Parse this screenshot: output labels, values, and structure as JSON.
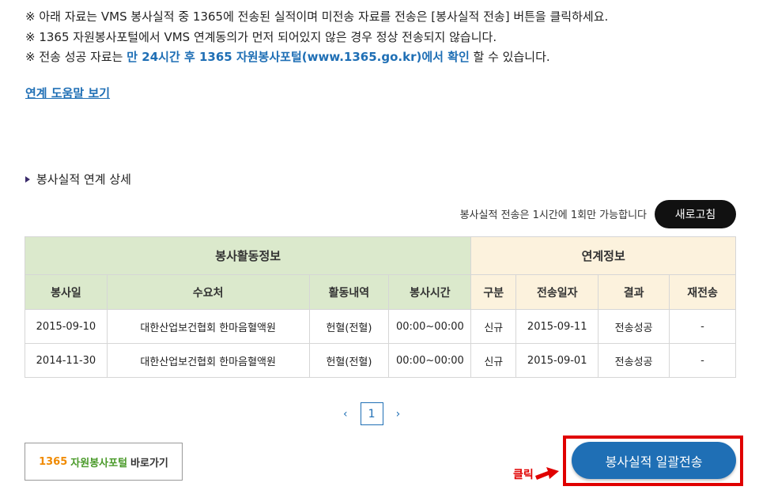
{
  "notices": [
    {
      "text": "※ 아래 자료는 VMS 봉사실적 중 1365에 전송된 실적이며 미전송 자료를 전송은 [봉사실적 전송] 버튼을 클릭하세요."
    },
    {
      "text": "※ 1365 자원봉사포털에서 VMS 연계동의가 먼저 되어있지 않은 경우 정상 전송되지 않습니다."
    },
    {
      "prefix": "※ 전송 성공 자료는 ",
      "highlight": "만 24시간 후 1365 자원봉사포털(www.1365.go.kr)에서 확인",
      "suffix": " 할 수 있습니다."
    }
  ],
  "help_link": "연계 도움말 보기",
  "section_title": "봉사실적 연계 상세",
  "limit_note": "봉사실적 전송은 1시간에 1회만 가능합니다",
  "refresh_label": "새로고침",
  "table": {
    "group_headers": [
      "봉사활동정보",
      "연계정보"
    ],
    "columns": [
      "봉사일",
      "수요처",
      "활동내역",
      "봉사시간",
      "구분",
      "전송일자",
      "결과",
      "재전송"
    ],
    "rows": [
      [
        "2015-09-10",
        "대한산업보건협회 한마음혈액원",
        "헌혈(전혈)",
        "00:00~00:00",
        "신규",
        "2015-09-11",
        "전송성공",
        "-"
      ],
      [
        "2014-11-30",
        "대한산업보건협회 한마음혈액원",
        "헌혈(전혈)",
        "00:00~00:00",
        "신규",
        "2015-09-01",
        "전송성공",
        "-"
      ]
    ]
  },
  "pagination": {
    "prev": "‹",
    "current": "1",
    "next": "›"
  },
  "portal_button": {
    "num": "1365",
    "name": "자원봉사포털",
    "go": "바로가기"
  },
  "bulk_send_label": "봉사실적 일괄전송",
  "annotation": {
    "click_label": "클릭"
  },
  "colors": {
    "accent": "#1f6fb5",
    "highlight": "#e00000",
    "activity_header": "#dbe9cc",
    "link_header": "#fcf2dd"
  }
}
